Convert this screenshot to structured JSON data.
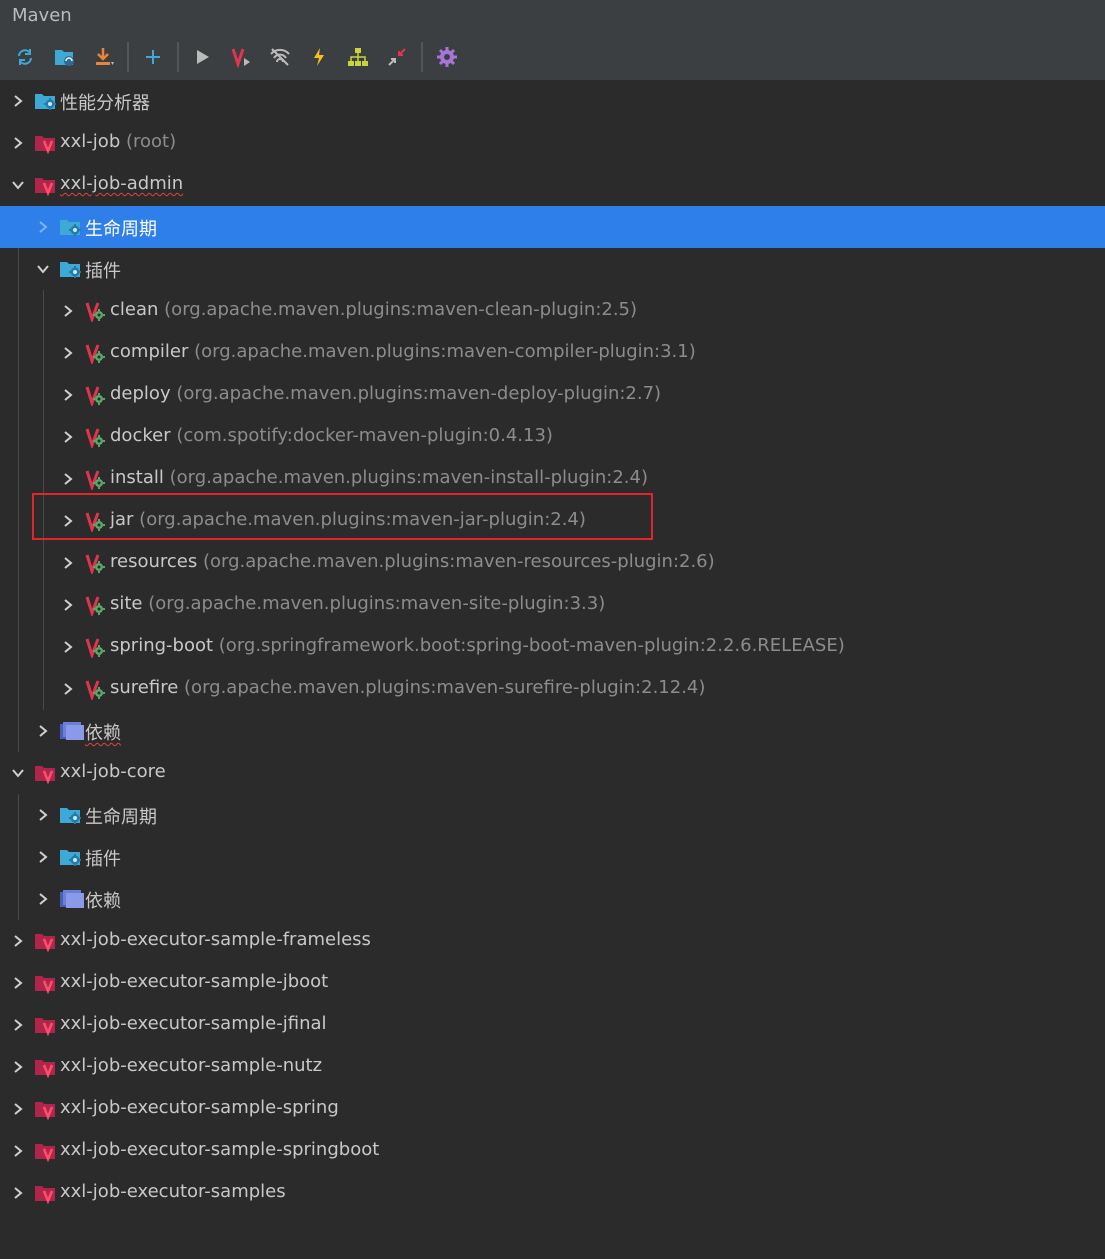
{
  "panel": {
    "title": "Maven"
  },
  "toolbar": {
    "buttons": [
      {
        "name": "reload-icon"
      },
      {
        "name": "folder-sync-icon"
      },
      {
        "name": "download-icon"
      },
      {
        "name": "add-icon"
      },
      {
        "name": "run-icon"
      },
      {
        "name": "maven-goal-icon"
      },
      {
        "name": "toggle-offline-icon"
      },
      {
        "name": "skip-tests-icon"
      },
      {
        "name": "show-dependencies-icon"
      },
      {
        "name": "collapse-all-icon"
      },
      {
        "name": "settings-icon"
      }
    ]
  },
  "tree": {
    "rows": [
      {
        "label": "性能分析器",
        "sub": ""
      },
      {
        "label": "xxl-job",
        "sub": "(root)"
      },
      {
        "label": "xxl-job-admin",
        "sub": ""
      },
      {
        "label": "生命周期",
        "sub": ""
      },
      {
        "label": "插件",
        "sub": ""
      },
      {
        "label": "clean",
        "sub": "(org.apache.maven.plugins:maven-clean-plugin:2.5)"
      },
      {
        "label": "compiler",
        "sub": "(org.apache.maven.plugins:maven-compiler-plugin:3.1)"
      },
      {
        "label": "deploy",
        "sub": "(org.apache.maven.plugins:maven-deploy-plugin:2.7)"
      },
      {
        "label": "docker",
        "sub": "(com.spotify:docker-maven-plugin:0.4.13)"
      },
      {
        "label": "install",
        "sub": "(org.apache.maven.plugins:maven-install-plugin:2.4)"
      },
      {
        "label": "jar",
        "sub": "(org.apache.maven.plugins:maven-jar-plugin:2.4)"
      },
      {
        "label": "resources",
        "sub": "(org.apache.maven.plugins:maven-resources-plugin:2.6)"
      },
      {
        "label": "site",
        "sub": "(org.apache.maven.plugins:maven-site-plugin:3.3)"
      },
      {
        "label": "spring-boot",
        "sub": "(org.springframework.boot:spring-boot-maven-plugin:2.2.6.RELEASE)"
      },
      {
        "label": "surefire",
        "sub": "(org.apache.maven.plugins:maven-surefire-plugin:2.12.4)"
      },
      {
        "label": "依赖",
        "sub": ""
      },
      {
        "label": "xxl-job-core",
        "sub": ""
      },
      {
        "label": "生命周期",
        "sub": ""
      },
      {
        "label": "插件",
        "sub": ""
      },
      {
        "label": "依赖",
        "sub": ""
      },
      {
        "label": "xxl-job-executor-sample-frameless",
        "sub": ""
      },
      {
        "label": "xxl-job-executor-sample-jboot",
        "sub": ""
      },
      {
        "label": "xxl-job-executor-sample-jfinal",
        "sub": ""
      },
      {
        "label": "xxl-job-executor-sample-nutz",
        "sub": ""
      },
      {
        "label": "xxl-job-executor-sample-spring",
        "sub": ""
      },
      {
        "label": "xxl-job-executor-sample-springboot",
        "sub": ""
      },
      {
        "label": "xxl-job-executor-samples",
        "sub": ""
      }
    ]
  },
  "colors": {
    "background": "#2b2b2b",
    "selection": "#2f7fea",
    "highlight_box": "#e0262d",
    "text": "#c8c8c8",
    "secondary_text": "#8c8c8c"
  }
}
